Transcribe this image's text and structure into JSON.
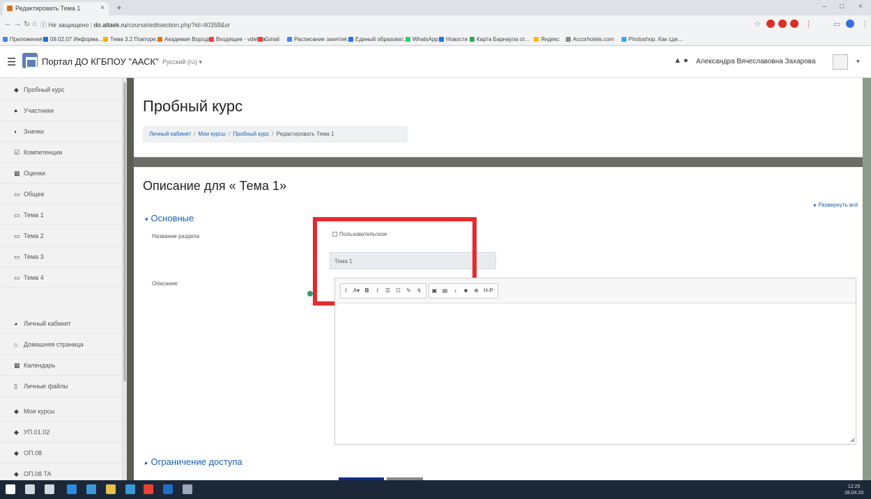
{
  "browser": {
    "tab_title": "Редактировать Тема 1",
    "tab_close": "×",
    "new_tab": "+",
    "window_controls": [
      "–",
      "□",
      "×"
    ],
    "url_security": "Не защищено",
    "url_host": "do.altaek.ru",
    "url_path": "/course/editsection.php?id=40358&sr",
    "bookmarks": [
      {
        "label": "Приложения",
        "color": "#4285f4"
      },
      {
        "label": "09.02.07 Информа...",
        "color": "#1a73e8"
      },
      {
        "label": "Тема 3.2 Повторе...",
        "color": "#f4b400"
      },
      {
        "label": "Академия Ворлдс...",
        "color": "#e8710a"
      },
      {
        "label": "Входящие - vdela a...",
        "color": "#ea4335"
      },
      {
        "label": "Gmail",
        "color": "#ea4335"
      },
      {
        "label": "Расписание занятия...",
        "color": "#4285f4"
      },
      {
        "label": "Единый образоват...",
        "color": "#1a73e8"
      },
      {
        "label": "WhatsApp",
        "color": "#25d366"
      },
      {
        "label": "Новости",
        "color": "#1a73e8"
      },
      {
        "label": "Карта Барнаула от...",
        "color": "#34a853"
      },
      {
        "label": "Яндекс",
        "color": "#fbbc04"
      },
      {
        "label": "Accorhotels.com",
        "color": "#7f8c8d"
      },
      {
        "label": "Photoshop. Как сде...",
        "color": "#31a8ff"
      }
    ]
  },
  "navbar": {
    "site_name": "Портал ДО КГБПОУ \"ААСК\"",
    "language": "Русский (ru) ▾",
    "user_name": "Александра Вячеславовна Захарова",
    "caret": "▾"
  },
  "sidebar": {
    "items": [
      {
        "label": "Пробный курс",
        "icon": "graduation-cap-icon",
        "glyph": "◆"
      },
      {
        "label": "Участники",
        "icon": "users-icon",
        "glyph": "●"
      },
      {
        "label": "Значки",
        "icon": "badge-icon",
        "glyph": "◐"
      },
      {
        "label": "Компетенции",
        "icon": "check-square-icon",
        "glyph": "☑"
      },
      {
        "label": "Оценки",
        "icon": "table-icon",
        "glyph": "▦"
      },
      {
        "label": "Общее",
        "icon": "folder-icon",
        "glyph": "▭"
      },
      {
        "label": "Тема 1",
        "icon": "folder-icon",
        "glyph": "▭"
      },
      {
        "label": "Тема 2",
        "icon": "folder-icon",
        "glyph": "▭"
      },
      {
        "label": "Тема 3",
        "icon": "folder-icon",
        "glyph": "▭"
      },
      {
        "label": "Тема 4",
        "icon": "folder-icon",
        "glyph": "▭"
      },
      {
        "label": "Личный кабинет",
        "icon": "dashboard-icon",
        "glyph": "◕"
      },
      {
        "label": "Домашняя страница",
        "icon": "home-icon",
        "glyph": "⌂"
      },
      {
        "label": "Календарь",
        "icon": "calendar-icon",
        "glyph": "▦"
      },
      {
        "label": "Личные файлы",
        "icon": "file-icon",
        "glyph": "▯"
      },
      {
        "label": "Мои курсы",
        "icon": "graduation-cap-icon",
        "glyph": "◆"
      },
      {
        "label": "УП.01.02",
        "icon": "graduation-cap-icon",
        "glyph": "◆"
      },
      {
        "label": "ОП.08",
        "icon": "graduation-cap-icon",
        "glyph": "◆"
      },
      {
        "label": "ОП.08 ТА",
        "icon": "graduation-cap-icon",
        "glyph": "◆"
      }
    ]
  },
  "header": {
    "course_title": "Пробный курс",
    "breadcrumb": [
      "Личный кабинет",
      "Мои курсы",
      "Пробный курс",
      "Редактировать Тема 1"
    ],
    "separator": "/"
  },
  "form": {
    "page_heading": "Описание для « Тема 1»",
    "expand_all": "▸ Развернуть всё",
    "section_general": "Основные",
    "section_caret": "▾",
    "label_section_name": "Название раздела",
    "checkbox_custom": "Пользовательское",
    "section_name_value": "Тема 1",
    "label_description": "Описание",
    "section_restrict": "Ограничение доступа",
    "restrict_caret": "▸"
  },
  "editor": {
    "toolbar_group1": [
      "I",
      "A▾",
      "B",
      "I",
      "☰",
      "☷",
      "✎",
      "↯"
    ],
    "toolbar_group2": [
      "▣",
      "▤",
      "♪",
      "■",
      "⊕",
      "H-P"
    ],
    "resize_glyph": "◢"
  },
  "taskbar": {
    "time": "12:25",
    "date": "28.04.20",
    "apps": [
      {
        "name": "windows-start-icon",
        "color": "#ffffff"
      },
      {
        "name": "search-icon",
        "color": "#cfd8e3"
      },
      {
        "name": "task-view-icon",
        "color": "#cfd8e3"
      },
      {
        "name": "ie-icon",
        "color": "#2b8ae2"
      },
      {
        "name": "store-icon",
        "color": "#3a9ad9"
      },
      {
        "name": "files-icon",
        "color": "#e6c04a"
      },
      {
        "name": "mail-icon",
        "color": "#3a9ad9"
      },
      {
        "name": "chrome-icon",
        "color": "#e94235"
      },
      {
        "name": "office-icon",
        "color": "#1e6fc8"
      },
      {
        "name": "paint-icon",
        "color": "#9aa7b8"
      }
    ]
  },
  "colors": {
    "accent": "#1a5fb4",
    "highlight_box": "#e52a2f",
    "save_button": "#0f2b8c"
  }
}
